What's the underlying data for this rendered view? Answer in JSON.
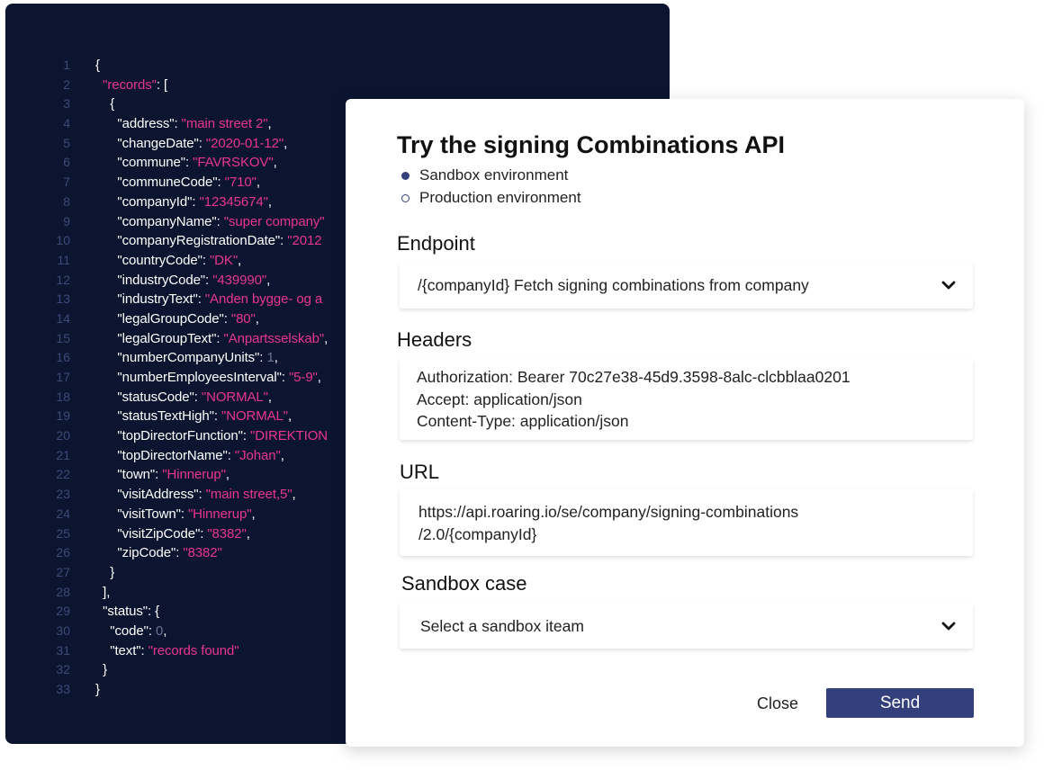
{
  "code_panel": {
    "line_numbers": [
      "1",
      "2",
      "3",
      "4",
      "5",
      "6",
      "7",
      "8",
      "9",
      "10",
      "11",
      "12",
      "13",
      "14",
      "15",
      "16",
      "17",
      "18",
      "19",
      "20",
      "21",
      "22",
      "23",
      "24",
      "25",
      "26",
      "27",
      "28",
      "29",
      "30",
      "31",
      "32",
      "33"
    ],
    "lines": [
      [
        {
          "t": "{",
          "c": "punc"
        }
      ],
      [
        {
          "t": "  ",
          "c": "punc"
        },
        {
          "t": "\"records\"",
          "c": "str"
        },
        {
          "t": ": [",
          "c": "punc"
        }
      ],
      [
        {
          "t": "    {",
          "c": "punc"
        }
      ],
      [
        {
          "t": "      \"address\"",
          "c": "key"
        },
        {
          "t": ": ",
          "c": "punc"
        },
        {
          "t": "\"main street 2\"",
          "c": "str"
        },
        {
          "t": ",",
          "c": "punc"
        }
      ],
      [
        {
          "t": "      \"changeDate\"",
          "c": "key"
        },
        {
          "t": ": ",
          "c": "punc"
        },
        {
          "t": "\"2020-01-12\"",
          "c": "str"
        },
        {
          "t": ",",
          "c": "punc"
        }
      ],
      [
        {
          "t": "      \"commune\"",
          "c": "key"
        },
        {
          "t": ": ",
          "c": "punc"
        },
        {
          "t": "\"FAVRSKOV\"",
          "c": "str"
        },
        {
          "t": ",",
          "c": "punc"
        }
      ],
      [
        {
          "t": "      \"communeCode\"",
          "c": "key"
        },
        {
          "t": ": ",
          "c": "punc"
        },
        {
          "t": "\"710\"",
          "c": "str"
        },
        {
          "t": ",",
          "c": "punc"
        }
      ],
      [
        {
          "t": "      \"companyId\"",
          "c": "key"
        },
        {
          "t": ": ",
          "c": "punc"
        },
        {
          "t": "\"12345674\"",
          "c": "str"
        },
        {
          "t": ",",
          "c": "punc"
        }
      ],
      [
        {
          "t": "      \"companyName\"",
          "c": "key"
        },
        {
          "t": ": ",
          "c": "punc"
        },
        {
          "t": "\"super company\"",
          "c": "str"
        }
      ],
      [
        {
          "t": "      \"companyRegistrationDate\"",
          "c": "key"
        },
        {
          "t": ": ",
          "c": "punc"
        },
        {
          "t": "\"2012",
          "c": "str"
        }
      ],
      [
        {
          "t": "      \"countryCode\"",
          "c": "key"
        },
        {
          "t": ": ",
          "c": "punc"
        },
        {
          "t": "\"DK\"",
          "c": "str"
        },
        {
          "t": ",",
          "c": "punc"
        }
      ],
      [
        {
          "t": "      \"industryCode\"",
          "c": "key"
        },
        {
          "t": ": ",
          "c": "punc"
        },
        {
          "t": "\"439990\"",
          "c": "str"
        },
        {
          "t": ",",
          "c": "punc"
        }
      ],
      [
        {
          "t": "      \"industryText\"",
          "c": "key"
        },
        {
          "t": ": ",
          "c": "punc"
        },
        {
          "t": "\"Anden bygge- og a",
          "c": "str"
        }
      ],
      [
        {
          "t": "      \"legalGroupCode\"",
          "c": "key"
        },
        {
          "t": ": ",
          "c": "punc"
        },
        {
          "t": "\"80\"",
          "c": "str"
        },
        {
          "t": ",",
          "c": "punc"
        }
      ],
      [
        {
          "t": "      \"legalGroupText\"",
          "c": "key"
        },
        {
          "t": ": ",
          "c": "punc"
        },
        {
          "t": "\"Anpartsselskab\"",
          "c": "str"
        },
        {
          "t": ",",
          "c": "punc"
        }
      ],
      [
        {
          "t": "      \"numberCompanyUnits\"",
          "c": "key"
        },
        {
          "t": ": ",
          "c": "punc"
        },
        {
          "t": "1",
          "c": "num"
        },
        {
          "t": ",",
          "c": "punc"
        }
      ],
      [
        {
          "t": "      \"numberEmployeesInterval\"",
          "c": "key"
        },
        {
          "t": ": ",
          "c": "punc"
        },
        {
          "t": "\"5-9\"",
          "c": "str"
        },
        {
          "t": ",",
          "c": "punc"
        }
      ],
      [
        {
          "t": "      \"statusCode\"",
          "c": "key"
        },
        {
          "t": ": ",
          "c": "punc"
        },
        {
          "t": "\"NORMAL\"",
          "c": "str"
        },
        {
          "t": ",",
          "c": "punc"
        }
      ],
      [
        {
          "t": "      \"statusTextHigh\"",
          "c": "key"
        },
        {
          "t": ": ",
          "c": "punc"
        },
        {
          "t": "\"NORMAL\"",
          "c": "str"
        },
        {
          "t": ",",
          "c": "punc"
        }
      ],
      [
        {
          "t": "      \"topDirectorFunction\"",
          "c": "key"
        },
        {
          "t": ": ",
          "c": "punc"
        },
        {
          "t": "\"DIREKTION",
          "c": "str"
        }
      ],
      [
        {
          "t": "      \"topDirectorName\"",
          "c": "key"
        },
        {
          "t": ": ",
          "c": "punc"
        },
        {
          "t": "\"Johan\"",
          "c": "str"
        },
        {
          "t": ",",
          "c": "punc"
        }
      ],
      [
        {
          "t": "      \"town\"",
          "c": "key"
        },
        {
          "t": ": ",
          "c": "punc"
        },
        {
          "t": "\"Hinnerup\"",
          "c": "str"
        },
        {
          "t": ",",
          "c": "punc"
        }
      ],
      [
        {
          "t": "      \"visitAddress\"",
          "c": "key"
        },
        {
          "t": ": ",
          "c": "punc"
        },
        {
          "t": "\"main street,5\"",
          "c": "str"
        },
        {
          "t": ",",
          "c": "punc"
        }
      ],
      [
        {
          "t": "      \"visitTown\"",
          "c": "key"
        },
        {
          "t": ": ",
          "c": "punc"
        },
        {
          "t": "\"Hinnerup\"",
          "c": "str"
        },
        {
          "t": ",",
          "c": "punc"
        }
      ],
      [
        {
          "t": "      \"visitZipCode\"",
          "c": "key"
        },
        {
          "t": ": ",
          "c": "punc"
        },
        {
          "t": "\"8382\"",
          "c": "str"
        },
        {
          "t": ",",
          "c": "punc"
        }
      ],
      [
        {
          "t": "      \"zipCode\"",
          "c": "key"
        },
        {
          "t": ": ",
          "c": "punc"
        },
        {
          "t": "\"8382\"",
          "c": "str"
        }
      ],
      [
        {
          "t": "    }",
          "c": "punc"
        }
      ],
      [
        {
          "t": "  ],",
          "c": "punc"
        }
      ],
      [
        {
          "t": "  \"status\"",
          "c": "key"
        },
        {
          "t": ": {",
          "c": "punc"
        }
      ],
      [
        {
          "t": "    \"code\"",
          "c": "key"
        },
        {
          "t": ": ",
          "c": "punc"
        },
        {
          "t": "0",
          "c": "num"
        },
        {
          "t": ",",
          "c": "punc"
        }
      ],
      [
        {
          "t": "    \"text\"",
          "c": "key"
        },
        {
          "t": ": ",
          "c": "punc"
        },
        {
          "t": "\"records found\"",
          "c": "str"
        }
      ],
      [
        {
          "t": "  }",
          "c": "punc"
        }
      ],
      [
        {
          "t": "}",
          "c": "punc"
        }
      ]
    ]
  },
  "dialog": {
    "title": "Try the signing Combinations API",
    "environments": [
      {
        "label": "Sandbox environment",
        "selected": true
      },
      {
        "label": "Production environment",
        "selected": false
      }
    ],
    "endpoint": {
      "label": "Endpoint",
      "value": "/{companyId} Fetch signing combinations from company",
      "icon": "chevron-down-icon"
    },
    "headers": {
      "label": "Headers",
      "lines": [
        "Authorization: Bearer 70c27e38-45d9.3598-8alc-clcbblaa0201",
        "Accept: application/json",
        "Content-Type: application/json"
      ]
    },
    "url": {
      "label": "URL",
      "lines": [
        "https://api.roaring.io/se/company/signing-combinations",
        "/2.0/{companyId}"
      ]
    },
    "sandbox_case": {
      "label": "Sandbox case",
      "placeholder": "Select a sandbox iteam",
      "icon": "chevron-down-icon"
    },
    "close_label": "Close",
    "send_label": "Send"
  },
  "colors": {
    "code_bg": "#0c1530",
    "string": "#e8368f",
    "line_number": "#3d4a78",
    "accent": "#34407c"
  }
}
